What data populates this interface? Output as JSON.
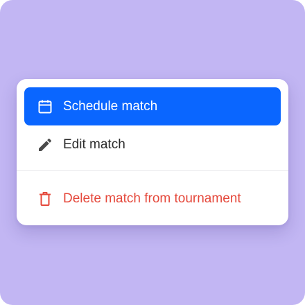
{
  "menu": {
    "items": [
      {
        "label": "Schedule match",
        "icon": "calendar-icon",
        "state": "highlighted"
      },
      {
        "label": "Edit match",
        "icon": "pencil-icon"
      },
      {
        "label": "Delete match from tournament",
        "icon": "trash-icon",
        "variant": "destructive"
      }
    ]
  },
  "colors": {
    "background": "#c2b6f3",
    "highlight": "#0a66ff",
    "destructive": "#e5483b",
    "text": "#2b2b2b"
  }
}
